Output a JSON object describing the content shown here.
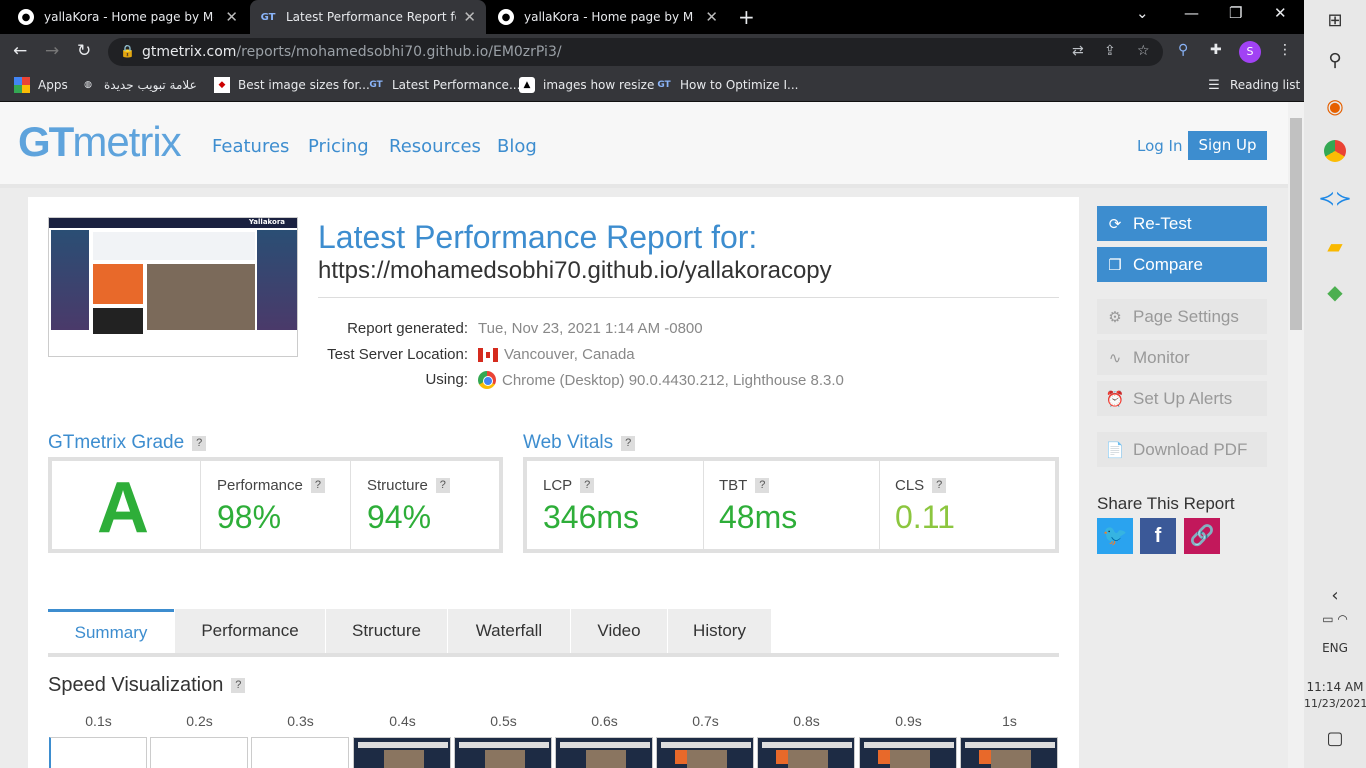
{
  "browser": {
    "tabs": [
      {
        "title": "yallaKora - Home page by Mohan",
        "favicon": "github-icon"
      },
      {
        "title": "Latest Performance Report for: ht",
        "favicon": "gtmetrix-icon"
      },
      {
        "title": "yallaKora - Home page by Mohan",
        "favicon": "github-icon"
      }
    ],
    "url_host": "gtmetrix.com",
    "url_path": "/reports/mohamedsobhi70.github.io/EM0zrPi3/",
    "profile_initial": "S",
    "bookmarks": [
      {
        "label": "Apps"
      },
      {
        "label": "علامة تبويب جديدة"
      },
      {
        "label": "Best image sizes for..."
      },
      {
        "label": "Latest Performance..."
      },
      {
        "label": "images how resize"
      },
      {
        "label": "How to Optimize I..."
      }
    ],
    "reading_list": "Reading list"
  },
  "site": {
    "logo_a": "GT",
    "logo_b": "metrix",
    "nav": [
      "Features",
      "Pricing",
      "Resources",
      "Blog"
    ],
    "login": "Log In",
    "signup": "Sign Up"
  },
  "report": {
    "title": "Latest Performance Report for:",
    "url": "https://mohamedsobhi70.github.io/yallakoracopy",
    "meta": [
      {
        "label": "Report generated:",
        "value": "Tue, Nov 23, 2021 1:14 AM -0800"
      },
      {
        "label": "Test Server Location:",
        "value": "Vancouver, Canada"
      },
      {
        "label": "Using:",
        "value": "Chrome (Desktop) 90.0.4430.212, Lighthouse 8.3.0"
      }
    ],
    "thumb_logo": "Yallakora"
  },
  "grade": {
    "heading": "GTmetrix Grade",
    "letter": "A",
    "performance_label": "Performance",
    "performance_value": "98%",
    "structure_label": "Structure",
    "structure_value": "94%"
  },
  "vitals": {
    "heading": "Web Vitals",
    "items": [
      {
        "label": "LCP",
        "value": "346ms"
      },
      {
        "label": "TBT",
        "value": "48ms"
      },
      {
        "label": "CLS",
        "value": "0.11"
      }
    ]
  },
  "report_tabs": [
    "Summary",
    "Performance",
    "Structure",
    "Waterfall",
    "Video",
    "History"
  ],
  "speed": {
    "heading": "Speed Visualization",
    "frames": [
      "0.1s",
      "0.2s",
      "0.3s",
      "0.4s",
      "0.5s",
      "0.6s",
      "0.7s",
      "0.8s",
      "0.9s",
      "1s"
    ]
  },
  "sidebar": {
    "retest": "Re-Test",
    "compare": "Compare",
    "page_settings": "Page Settings",
    "monitor": "Monitor",
    "alerts": "Set Up Alerts",
    "pdf": "Download PDF",
    "share": "Share This Report"
  },
  "taskbar": {
    "lang": "ENG",
    "time": "11:14 AM",
    "date": "11/23/2021"
  },
  "colors": {
    "brand_blue": "#3d8dcf",
    "grade_green": "#2eae39",
    "cls_green": "#8cc63f"
  }
}
